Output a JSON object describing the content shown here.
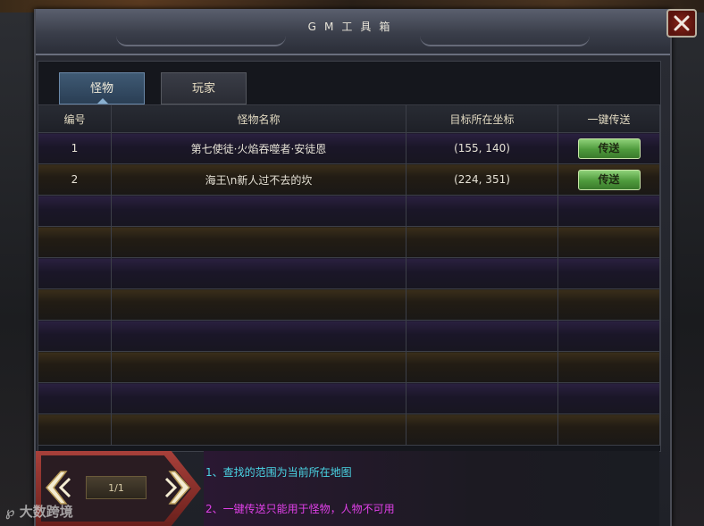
{
  "window": {
    "title": "GM工具箱"
  },
  "tabs": [
    {
      "label": "怪物",
      "active": true
    },
    {
      "label": "玩家",
      "active": false
    }
  ],
  "table": {
    "headers": [
      "编号",
      "怪物名称",
      "目标所在坐标",
      "一键传送"
    ],
    "rows": [
      {
        "id": "1",
        "name": "第七使徒·火焰吞噬者·安徒恩",
        "coords": "(155, 140)",
        "action": "传送"
      },
      {
        "id": "2",
        "name": "海王\\n新人过不去的坎",
        "coords": "(224, 351)",
        "action": "传送"
      }
    ],
    "empty_rows": 8
  },
  "pagination": {
    "text": "1/1"
  },
  "tips": [
    "1、查找的范围为当前所在地图",
    "2、一键传送只能用于怪物，人物不可用"
  ],
  "watermark": "大数跨境",
  "colors": {
    "tip1": "#4ad6e6",
    "tip2": "#e040e8",
    "send_button": "#5aa846",
    "close_button": "#8a2418"
  },
  "icons": [
    "close-icon",
    "arrow-left-icon",
    "arrow-right-icon"
  ]
}
